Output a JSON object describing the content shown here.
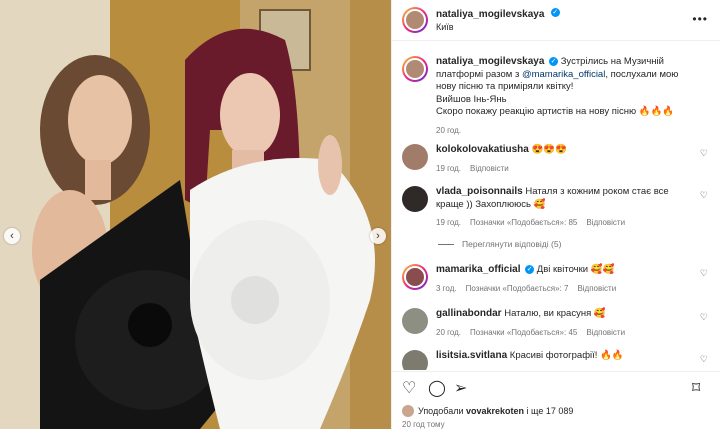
{
  "post": {
    "username": "nataliya_mogilevskaya",
    "location": "Київ",
    "more_icon": "ellipsis-icon"
  },
  "caption": {
    "username": "nataliya_mogilevskaya",
    "text1": "Зустрілись на Музичній платформі разом з",
    "mention": "@mamarika_official",
    "text2": ", послухали мою нову пісню та приміряли квітку!",
    "line2": "Вийшов Інь-Янь",
    "line3": "Скоро покажу реакцію артистів на нову пісню 🔥🔥🔥",
    "time": "20 год."
  },
  "comments": [
    {
      "username": "kolokolovakatiusha",
      "text": "😍😍😍",
      "time": "19 год.",
      "likes": "",
      "reply": "Відповісти",
      "avatar_color": "#a17c6a"
    },
    {
      "username": "vlada_poisonnails",
      "text": "Наталя з кожним роком стає все краще )) Захоплююсь 🥰",
      "time": "19 год.",
      "likes": "Позначки «Подобається»: 85",
      "reply": "Відповісти",
      "avatar_color": "#2f2a28"
    },
    {
      "username": "mamarika_official",
      "text": "Дві квіточки 🥰🥰",
      "time": "3 год.",
      "likes": "Позначки «Подобається»: 7",
      "reply": "Відповісти",
      "avatar_color": "#8a4d4d"
    },
    {
      "username": "gallinabondar",
      "text": "Наталю, ви красуня 🥰",
      "time": "20 год.",
      "likes": "Позначки «Подобається»: 45",
      "reply": "Відповісти",
      "avatar_color": "#8d8f82"
    },
    {
      "username": "lisitsia.svitlana",
      "text": "Красиві фотографії! 🔥🔥",
      "time": "",
      "likes": "",
      "reply": "",
      "avatar_color": "#7d7a6e"
    }
  ],
  "replies_link": "Переглянути відповіді (5)",
  "actions": {
    "like_icon": "heart-icon",
    "comment_icon": "comment-icon",
    "share_icon": "share-icon",
    "save_icon": "bookmark-icon"
  },
  "likes": {
    "prefix": "Уподобали",
    "user": "vovakrekoten",
    "suffix": "і ще 17 089"
  },
  "post_time": "20 год тому",
  "colors": {
    "verified": "#0095f6",
    "link": "#00376b",
    "muted": "#737373"
  }
}
